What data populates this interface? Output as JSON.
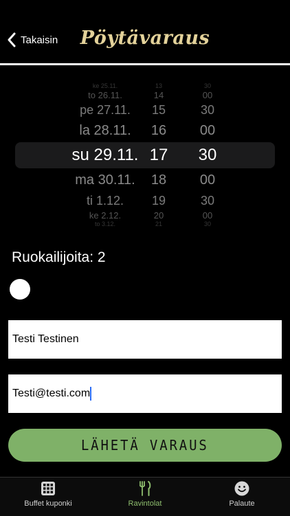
{
  "header": {
    "back_label": "Takaisin",
    "title": "Pöytävaraus"
  },
  "picker": {
    "days": [
      "ke 25.11.",
      "to 26.11.",
      "pe 27.11.",
      "la 28.11.",
      "su 29.11.",
      "ma 30.11.",
      "ti 1.12.",
      "ke 2.12.",
      "to 3.12."
    ],
    "hours": [
      "13",
      "14",
      "15",
      "16",
      "17",
      "18",
      "19",
      "20",
      "21"
    ],
    "minutes": [
      "30",
      "00",
      "30",
      "00",
      "30",
      "00",
      "30",
      "00",
      "30"
    ],
    "selected_index": 4
  },
  "diners": {
    "label": "Ruokailijoita: 2",
    "value": 2
  },
  "form": {
    "name_value": "Testi Testinen",
    "email_value": "Testi@testi.com",
    "submit_label": "LÄHETÄ VARAUS"
  },
  "tabs": [
    {
      "label": "Buffet kuponki",
      "icon": "grid-icon",
      "active": false
    },
    {
      "label": "Ravintolat",
      "icon": "fork-knife-icon",
      "active": true
    },
    {
      "label": "Palaute",
      "icon": "smiley-icon",
      "active": false
    }
  ],
  "colors": {
    "title": "#e3d29a",
    "accent_green": "#7fb168",
    "active_tab": "#8fbf6f"
  }
}
